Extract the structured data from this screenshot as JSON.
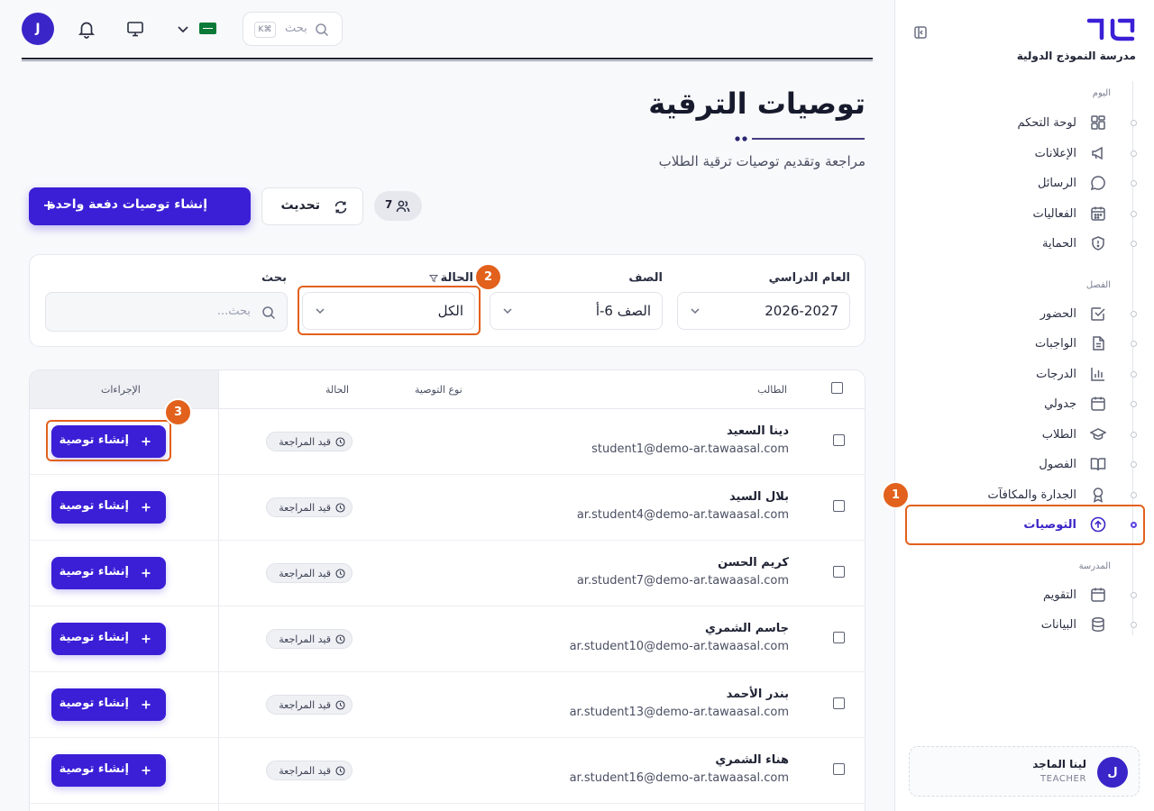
{
  "sidebar": {
    "school_name": "مدرسة النموذج الدولية",
    "sections": [
      {
        "label": "اليوم"
      },
      {
        "label": "الفصل"
      },
      {
        "label": "المدرسة"
      }
    ],
    "items": [
      {
        "label": "لوحة التحكم",
        "icon": "dashboard-icon"
      },
      {
        "label": "الإعلانات",
        "icon": "megaphone-icon"
      },
      {
        "label": "الرسائل",
        "icon": "message-icon"
      },
      {
        "label": "الفعاليات",
        "icon": "calendar-icon"
      },
      {
        "label": "الحماية",
        "icon": "shield-icon"
      },
      {
        "label": "الحضور",
        "icon": "check-square-icon"
      },
      {
        "label": "الواجبات",
        "icon": "document-icon"
      },
      {
        "label": "الدرجات",
        "icon": "bar-chart-icon"
      },
      {
        "label": "جدولي",
        "icon": "calendar-icon"
      },
      {
        "label": "الطلاب",
        "icon": "graduation-cap-icon"
      },
      {
        "label": "الفصول",
        "icon": "book-icon"
      },
      {
        "label": "الجدارة والمكافآت",
        "icon": "award-icon"
      },
      {
        "label": "التوصيات",
        "icon": "arrow-up-circle-icon",
        "active": true
      },
      {
        "label": "التقويم",
        "icon": "calendar-icon"
      },
      {
        "label": "البيانات",
        "icon": "database-icon"
      }
    ],
    "profile": {
      "initial": "ل",
      "name": "لينا الماجد",
      "role": "TEACHER"
    }
  },
  "topbar": {
    "avatar_initial": "J",
    "search_placeholder": "بحث",
    "shortcut": "K⌘"
  },
  "header": {
    "title": "توصيات الترقية",
    "subtitle": "مراجعة وتقديم توصيات ترقية الطلاب"
  },
  "actions": {
    "batch_label": "إنشاء توصيات دفعة واحدة",
    "refresh_label": "تحديث",
    "student_count": "7"
  },
  "filters": {
    "year_label": "العام الدراسي",
    "year_value": "2026-2027",
    "class_label": "الصف",
    "class_value": "الصف 6-أ",
    "status_label": "الحالة",
    "status_value": "الكل",
    "search_label": "بحث",
    "search_placeholder": "بحث..."
  },
  "table": {
    "headers": {
      "student": "الطالب",
      "type": "نوع التوصية",
      "status": "الحالة",
      "actions": "الإجراءات"
    },
    "status_text": "قيد المراجعة",
    "action_label": "إنشاء توصية",
    "rows": [
      {
        "name": "دينا السعيد",
        "email": "student1@demo-ar.tawaasal.com"
      },
      {
        "name": "بلال السيد",
        "email": "ar.student4@demo-ar.tawaasal.com"
      },
      {
        "name": "كريم الحسن",
        "email": "ar.student7@demo-ar.tawaasal.com"
      },
      {
        "name": "جاسم الشمري",
        "email": "ar.student10@demo-ar.tawaasal.com"
      },
      {
        "name": "بندر الأحمد",
        "email": "ar.student13@demo-ar.tawaasal.com"
      },
      {
        "name": "هناء الشمري",
        "email": "ar.student16@demo-ar.tawaasal.com"
      }
    ]
  },
  "annotations": {
    "step1": "1",
    "step2": "2",
    "step3": "3"
  },
  "colors": {
    "primary": "#3a1fd6",
    "highlight": "#e2611c",
    "text": "#1e2233"
  }
}
